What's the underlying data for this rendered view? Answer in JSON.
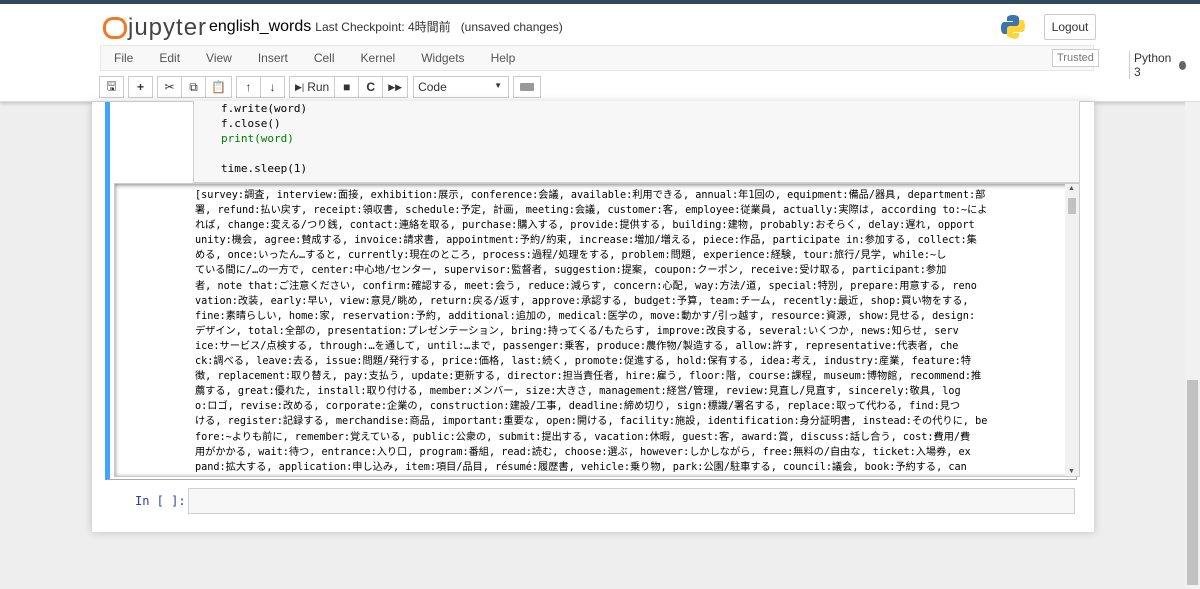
{
  "header": {
    "logo": "jupyter",
    "notebook_name": "english_words",
    "checkpoint": "Last Checkpoint: 4時間前",
    "unsaved": "(unsaved changes)",
    "logout": "Logout"
  },
  "menu": [
    "File",
    "Edit",
    "View",
    "Insert",
    "Cell",
    "Kernel",
    "Widgets",
    "Help"
  ],
  "status": {
    "trusted": "Trusted",
    "kernel": "Python 3"
  },
  "toolbar": {
    "run": "Run",
    "cell_type": "Code",
    "icons": [
      "save-icon",
      "plus-icon",
      "cut-icon",
      "copy-icon",
      "paste-icon",
      "arrow-up-icon",
      "arrow-down-icon",
      "run-icon",
      "stop-icon",
      "restart-icon",
      "fast-forward-icon",
      "keyboard-icon"
    ]
  },
  "code_lines": [
    "f.write(word)",
    "f.close()",
    "print(word)",
    "",
    "time.sleep(1)"
  ],
  "output_lines": [
    "[survey:調査, interview:面接, exhibition:展示, conference:会議, available:利用できる, annual:年1回の, equipment:備品/器具, department:部",
    "署, refund:払い戻す, receipt:領収書, schedule:予定, 計画, meeting:会議, customer:客, employee:従業員, actually:実際は, according to:~によ",
    "れば, change:変える/つり銭, contact:連絡を取る, purchase:購入する, provide:提供する, building:建物, probably:おそらく, delay:遅れ, opport",
    "unity:機会, agree:賛成する, invoice:請求書, appointment:予約/約束, increase:増加/増える, piece:作品, participate in:参加する, collect:集",
    "める, once:いったん…すると, currently:現在のところ, process:過程/処理をする, problem:問題, experience:経験, tour:旅行/見学, while:~し",
    "ている間に/…の一方で, center:中心地/センター, supervisor:監督者, suggestion:提案, coupon:クーポン, receive:受け取る, participant:参加",
    "者, note that:ご注意ください, confirm:確認する, meet:会う, reduce:減らす, concern:心配, way:方法/道, special:特別, prepare:用意する, reno",
    "vation:改装, early:早い, view:意見/眺め, return:戻る/返す, approve:承認する, budget:予算, team:チーム, recently:最近, shop:買い物をする,",
    "fine:素晴らしい, home:家, reservation:予約, additional:追加の, medical:医学の, move:動かす/引っ越す, resource:資源, show:見せる, design:",
    "デザイン, total:全部の, presentation:プレゼンテーション, bring:持ってくる/もたらす, improve:改良する, several:いくつか, news:知らせ, serv",
    "ice:サービス/点検する, through:…を通して, until:…まで, passenger:乗客, produce:農作物/製造する, allow:許す, representative:代表者, che",
    "ck:調べる, leave:去る, issue:問題/発行する, price:価格, last:続く, promote:促進する, hold:保有する, idea:考え, industry:産業, feature:特",
    "徴, replacement:取り替え, pay:支払う, update:更新する, director:担当責任者, hire:雇う, floor:階, course:課程, museum:博物館, recommend:推",
    "薦する, great:優れた, install:取り付ける, member:メンバー, size:大きさ, management:経営/管理, review:見直し/見直す, sincerely:敬具, log",
    "o:ロゴ, revise:改める, corporate:企業の, construction:建設/工事, deadline:締め切り, sign:標識/署名する, replace:取って代わる, find:見つ",
    "ける, register:記録する, merchandise:商品, important:重要な, open:開ける, facility:施設, identification:身分証明書, instead:その代りに, be",
    "fore:~よりも前に, remember:覚えている, public:公衆の, submit:提出する, vacation:休暇, guest:客, award:賞, discuss:話し合う, cost:費用/費",
    "用がかかる, wait:待つ, entrance:入り口, program:番組, read:読む, choose:選ぶ, however:しかしながら, free:無料の/自由な, ticket:入場券, ex",
    "pand:拡大する, application:申し込み, item:項目/品目, résumé:履歴書, vehicle:乗り物, park:公園/駐車する, council:議会, book:予約する, can"
  ],
  "next_cell": {
    "prompt": "In [ ]:"
  }
}
